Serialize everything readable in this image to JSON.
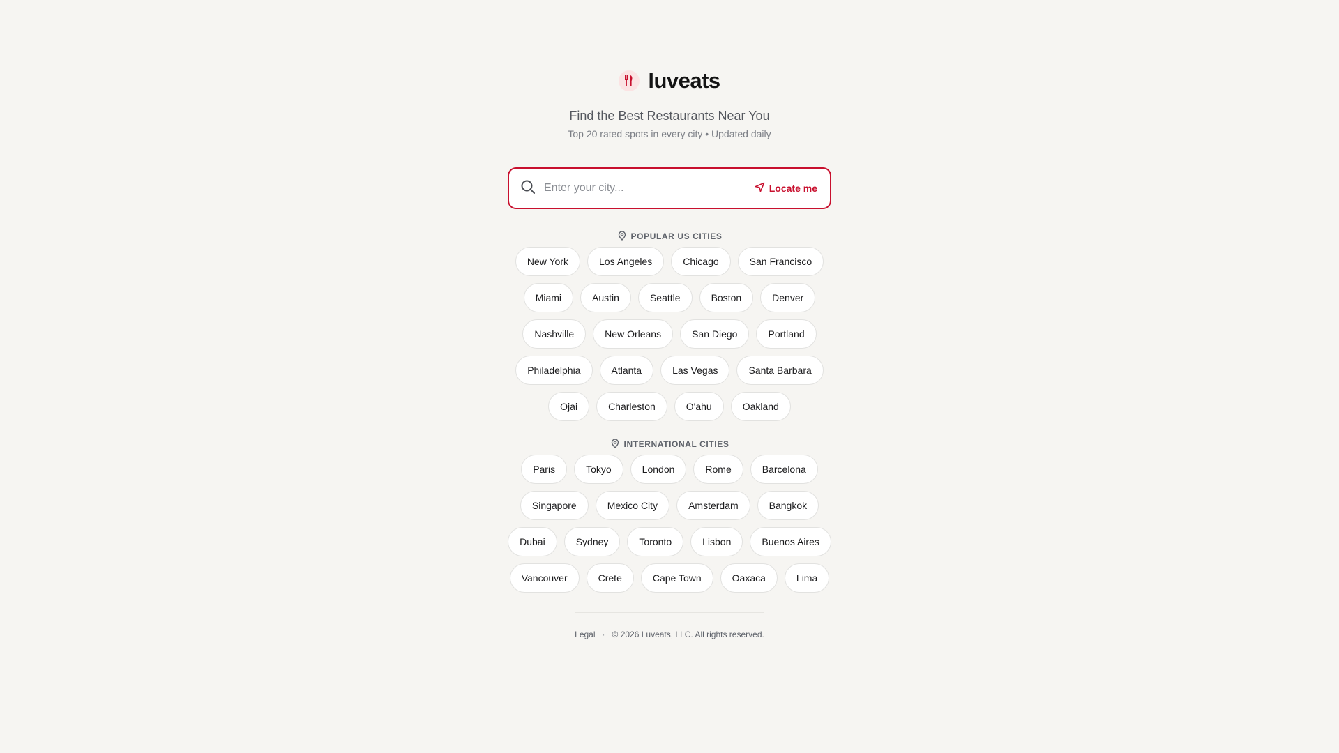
{
  "brand": {
    "name": "luveats",
    "tagline": "Find the Best Restaurants Near You",
    "subline": "Top 20 rated spots in every city • Updated daily",
    "accent": "#c8102e"
  },
  "search": {
    "placeholder": "Enter your city...",
    "value": "",
    "locate_label": "Locate me"
  },
  "us_section": {
    "title": "POPULAR US CITIES",
    "cities": [
      "New York",
      "Los Angeles",
      "Chicago",
      "San Francisco",
      "Miami",
      "Austin",
      "Seattle",
      "Boston",
      "Denver",
      "Nashville",
      "New Orleans",
      "San Diego",
      "Portland",
      "Philadelphia",
      "Atlanta",
      "Las Vegas",
      "Santa Barbara",
      "Ojai",
      "Charleston",
      "O'ahu",
      "Oakland"
    ]
  },
  "intl_section": {
    "title": "INTERNATIONAL CITIES",
    "cities": [
      "Paris",
      "Tokyo",
      "London",
      "Rome",
      "Barcelona",
      "Singapore",
      "Mexico City",
      "Amsterdam",
      "Bangkok",
      "Dubai",
      "Sydney",
      "Toronto",
      "Lisbon",
      "Buenos Aires",
      "Vancouver",
      "Crete",
      "Cape Town",
      "Oaxaca",
      "Lima"
    ]
  },
  "footer": {
    "legal": "Legal",
    "separator": "·",
    "copyright": "© 2026 Luveats, LLC. All rights reserved."
  }
}
